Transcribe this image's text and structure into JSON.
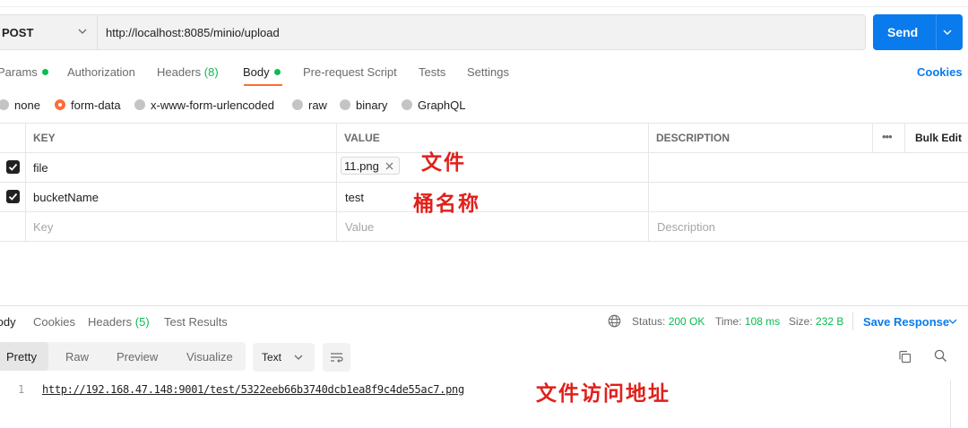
{
  "request": {
    "method": "POST",
    "url": "http://localhost:8085/minio/upload",
    "send_label": "Send"
  },
  "tabs": [
    {
      "label": "Params"
    },
    {
      "label": "Authorization"
    },
    {
      "label": "Headers",
      "count": "(8)"
    },
    {
      "label": "Body"
    },
    {
      "label": "Pre-request Script"
    },
    {
      "label": "Tests"
    },
    {
      "label": "Settings"
    }
  ],
  "cookies_label": "Cookies",
  "body_types": [
    "none",
    "form-data",
    "x-www-form-urlencoded",
    "raw",
    "binary",
    "GraphQL"
  ],
  "body_type_selected": "form-data",
  "table": {
    "headers": {
      "key": "KEY",
      "value": "VALUE",
      "description": "DESCRIPTION",
      "bulk_edit": "Bulk Edit",
      "more": "•••"
    },
    "rows": [
      {
        "key": "file",
        "value": "11.png",
        "type": "file",
        "checked": true
      },
      {
        "key": "bucketName",
        "value": "test",
        "type": "text",
        "checked": true
      }
    ],
    "placeholders": {
      "key": "Key",
      "value": "Value",
      "description": "Description"
    }
  },
  "annotations": {
    "file": "文件",
    "bucket": "桶名称",
    "url": "文件访问地址"
  },
  "response": {
    "tabs": [
      {
        "label": "Body"
      },
      {
        "label": "Cookies"
      },
      {
        "label": "Headers",
        "count": "(5)"
      },
      {
        "label": "Test Results"
      }
    ],
    "status_label": "Status:",
    "status_value": "200 OK",
    "time_label": "Time:",
    "time_value": "108 ms",
    "size_label": "Size:",
    "size_value": "232 B",
    "save_label": "Save Response",
    "views": [
      "Pretty",
      "Raw",
      "Preview",
      "Visualize"
    ],
    "format": "Text",
    "line_number": "1",
    "body_line": "http://192.168.47.148:9001/test/5322eeb66b3740dcb1ea8f9c4de55ac7.png"
  },
  "colors": {
    "accent": "#ff6c37",
    "primary": "#097bed",
    "success": "#0cbb52",
    "annotation": "#e0201b"
  }
}
